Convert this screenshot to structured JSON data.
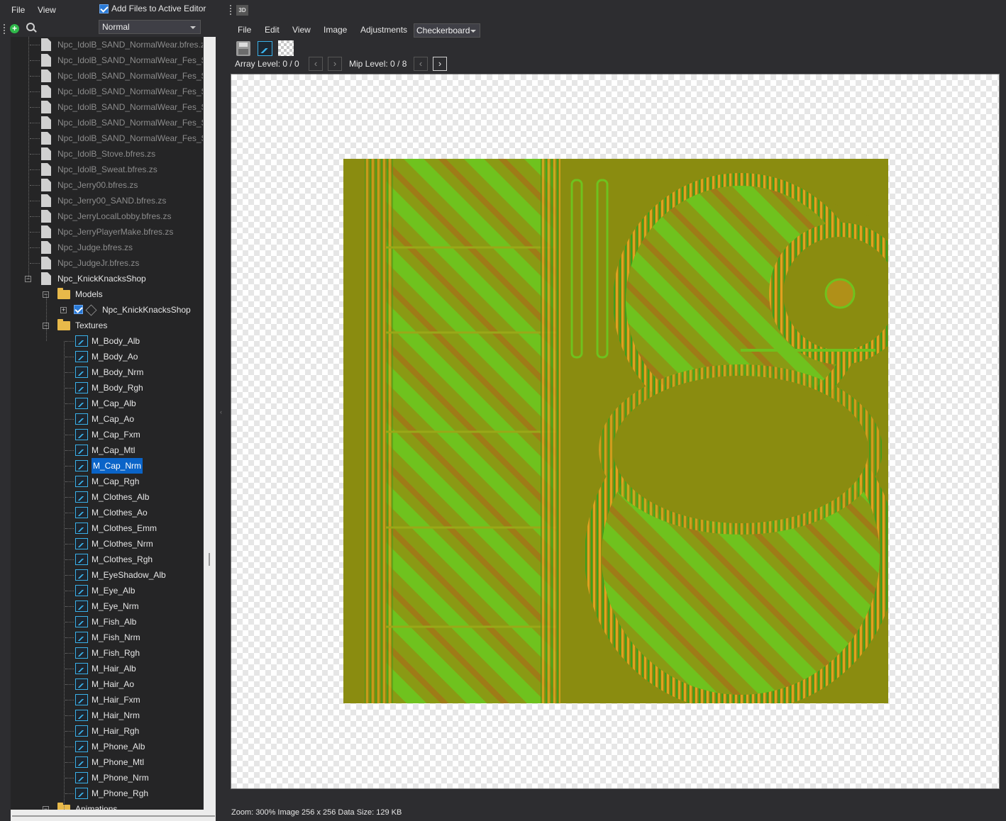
{
  "left_panel": {
    "menu": {
      "file": "File",
      "view": "View"
    },
    "add_files_label": "Add Files to Active Editor",
    "add_files_checked": true,
    "mode_select": "Normal",
    "tree": {
      "archive_files": [
        "Npc_IdolB_SAND_NormalWear.bfres.zs",
        "Npc_IdolB_SAND_NormalWear_Fes_Sand",
        "Npc_IdolB_SAND_NormalWear_Fes_Sand",
        "Npc_IdolB_SAND_NormalWear_Fes_Sand",
        "Npc_IdolB_SAND_NormalWear_Fes_Sand",
        "Npc_IdolB_SAND_NormalWear_Fes_Sand",
        "Npc_IdolB_SAND_NormalWear_Fes_Sand",
        "Npc_IdolB_Stove.bfres.zs",
        "Npc_IdolB_Sweat.bfres.zs",
        "Npc_Jerry00.bfres.zs",
        "Npc_Jerry00_SAND.bfres.zs",
        "Npc_JerryLocalLobby.bfres.zs",
        "Npc_JerryPlayerMake.bfres.zs",
        "Npc_Judge.bfres.zs",
        "Npc_JudgeJr.bfres.zs"
      ],
      "open_file": "Npc_KnickKnacksShop",
      "models_folder": "Models",
      "model_name": "Npc_KnickKnacksShop",
      "textures_folder": "Textures",
      "textures": [
        "M_Body_Alb",
        "M_Body_Ao",
        "M_Body_Nrm",
        "M_Body_Rgh",
        "M_Cap_Alb",
        "M_Cap_Ao",
        "M_Cap_Fxm",
        "M_Cap_Mtl",
        "M_Cap_Nrm",
        "M_Cap_Rgh",
        "M_Clothes_Alb",
        "M_Clothes_Ao",
        "M_Clothes_Emm",
        "M_Clothes_Nrm",
        "M_Clothes_Rgh",
        "M_EyeShadow_Alb",
        "M_Eye_Alb",
        "M_Eye_Nrm",
        "M_Fish_Alb",
        "M_Fish_Nrm",
        "M_Fish_Rgh",
        "M_Hair_Alb",
        "M_Hair_Ao",
        "M_Hair_Fxm",
        "M_Hair_Nrm",
        "M_Hair_Rgh",
        "M_Phone_Alb",
        "M_Phone_Mtl",
        "M_Phone_Nrm",
        "M_Phone_Rgh"
      ],
      "selected_texture": "M_Cap_Nrm",
      "animations_folder": "Animations"
    }
  },
  "right_panel": {
    "tab_3d": "3D",
    "menu": {
      "file": "File",
      "edit": "Edit",
      "view": "View",
      "image": "Image",
      "adjustments": "Adjustments"
    },
    "background_select": "Checkerboard",
    "array_level": "Array Level: 0 / 0",
    "mip_level": "Mip Level: 0 / 8",
    "status": "Zoom: 300% Image 256 x 256 Data Size: 129 KB"
  },
  "colors": {
    "panel_bg": "#2d2d30",
    "tree_bg": "#252526",
    "selection": "#0a64c8",
    "texture_base": "#8a8c10",
    "texture_green": "#6fc21e",
    "texture_red": "#c8561a"
  },
  "icons": {
    "add": "plus-circle-icon",
    "search": "search-icon",
    "file": "file-icon",
    "folder": "folder-icon",
    "texture": "image-icon",
    "model": "cube-icon",
    "save": "save-icon",
    "edit_image": "edit-image-icon",
    "background": "checkerboard-icon"
  }
}
